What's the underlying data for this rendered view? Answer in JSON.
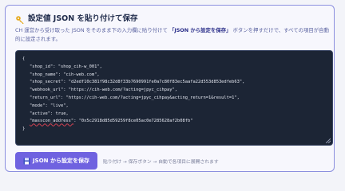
{
  "header": {
    "title": "設定値 JSON を貼り付けて保存",
    "icon": "key-icon"
  },
  "description": {
    "part1": "CH 運営から受け取った JSON をそのまま下の入力欄に貼り付けて",
    "highlight": "「JSON から設定を保存」",
    "part2": "ボタンを押すだけで、すべての項目が自動的に設定されます。"
  },
  "editor": {
    "open_brace": "{",
    "lines": [
      {
        "key": "\"shop_id\"",
        "value": "\"shop_cih-w_001\","
      },
      {
        "key": "\"shop_name\"",
        "value": "\"cih-web.com\","
      },
      {
        "key": "\"shop_secret\"",
        "value": "\"d2edf10c381f98c32d8f33b7690991fe0a7c80f83ec5aafa22d553d853edfeb63\","
      },
      {
        "key": "\"webhook_url\"",
        "value": "\"https://cih-web.com/?acting=jpyc_cihpay\","
      },
      {
        "key": "\"return_url\"",
        "value": "\"https://cih-web.com/?acting=jpyc_cihpay&acting_return=1&result=1\","
      },
      {
        "key": "\"mode\"",
        "value": "\"live\","
      },
      {
        "key": "\"active\"",
        "value": "true,"
      },
      {
        "key": "\"masscon_address\"",
        "value": "\"0x5c2918d85d59259f8ce05ac0e7285628af2b08fb\""
      }
    ],
    "close_brace": "}"
  },
  "apply_button": {
    "label": "JSON から設定を保存",
    "icon": "save-icon"
  },
  "hint": "貼り付け → 保存ボタン → 自動で各項目に展開されます",
  "colors": {
    "accent": "#6f62e0",
    "border": "#8c90df",
    "editor_bg": "#1c2535",
    "highlight_text": "#2b2f8a"
  }
}
